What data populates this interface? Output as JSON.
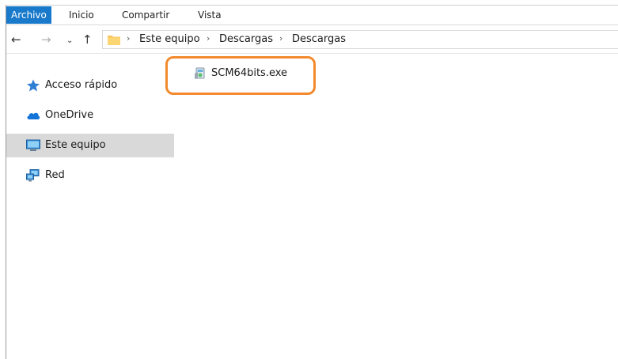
{
  "ribbon": {
    "tabs": [
      {
        "label": "Archivo"
      },
      {
        "label": "Inicio"
      },
      {
        "label": "Compartir"
      },
      {
        "label": "Vista"
      }
    ]
  },
  "navigation": {
    "breadcrumb": [
      "Este equipo",
      "Descargas",
      "Descargas"
    ]
  },
  "sidebar": {
    "items": [
      {
        "label": "Acceso rápido",
        "icon": "star-icon"
      },
      {
        "label": "OneDrive",
        "icon": "cloud-icon"
      },
      {
        "label": "Este equipo",
        "icon": "computer-icon",
        "selected": true
      },
      {
        "label": "Red",
        "icon": "network-icon"
      }
    ]
  },
  "files": [
    {
      "name": "SCM64bits.exe",
      "icon": "installer-icon"
    }
  ],
  "colors": {
    "accent": "#1979ca",
    "highlight": "#f28a2e",
    "selection": "#d9d9d9"
  }
}
